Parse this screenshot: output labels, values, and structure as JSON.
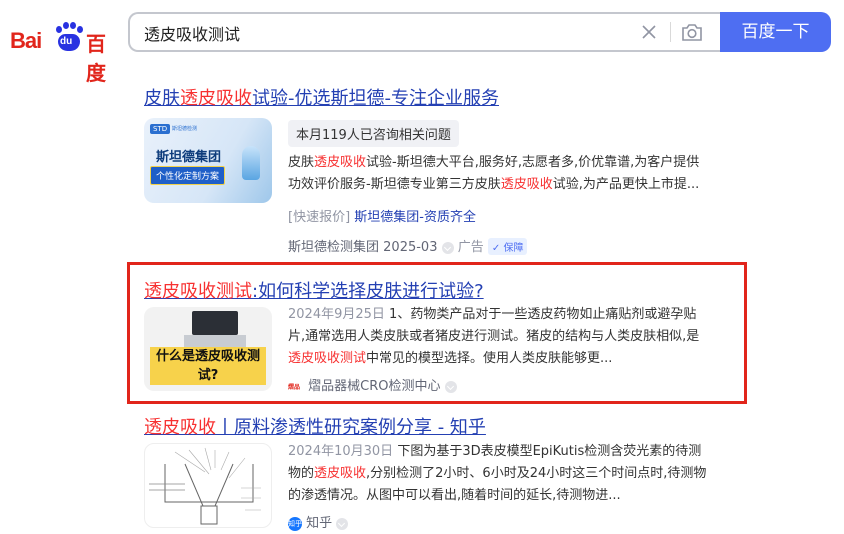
{
  "logo": {
    "bai": "Bai",
    "du": "du",
    "cn": "百度"
  },
  "search": {
    "query": "透皮吸收测试",
    "button_label": "百度一下"
  },
  "results": [
    {
      "title_pre": "皮肤",
      "title_hl": "透皮吸收",
      "title_post": "试验-优选斯坦德-专注企业服务",
      "thumb": {
        "logo": "STD",
        "logo_sub": "斯坦德检测",
        "headline": "斯坦德集团",
        "banner": "个性化定制方案"
      },
      "consult": "本月119人已咨询相关问题",
      "snip": [
        {
          "t": "皮肤",
          "hl": false
        },
        {
          "t": "透皮吸收",
          "hl": true
        },
        {
          "t": "试验-斯坦德大平台,服务好,志愿者多,价优靠谱,为客户提供功效评价服务-斯坦德专业第三方皮肤",
          "hl": false
        },
        {
          "t": "透皮吸收",
          "hl": true
        },
        {
          "t": "试验,为产品更快上市提...",
          "hl": false
        }
      ],
      "quick_tag": "[快速报价]",
      "quick_link": "斯坦德集团-资质齐全",
      "source": "斯坦德检测集团",
      "date": "2025-03",
      "ad": "广告",
      "guarantee": "保障"
    },
    {
      "title_hl": "透皮吸收测试",
      "title_post": ":如何科学选择皮肤进行试验?",
      "thumb": {
        "caption": "什么是透皮吸收测试?"
      },
      "date": "2024年9月25日",
      "snip": [
        {
          "t": "1、药物类产品对于一些透皮药物如止痛贴剂或避孕贴片,通常选用人类皮肤或者猪皮进行测试。猪皮的结构与人类皮肤相似,是",
          "hl": false
        },
        {
          "t": "透皮吸收测试",
          "hl": true
        },
        {
          "t": "中常见的模型选择。使用人类皮肤能够更...",
          "hl": false
        }
      ],
      "source": "熠品器械CRO检测中心",
      "source_logo": "熠品"
    },
    {
      "title_hl": "透皮吸收",
      "title_post": "丨原料渗透性研究案例分享 - 知乎",
      "date": "2024年10月30日",
      "snip": [
        {
          "t": "下图为基于3D表皮模型EpiKutis检测含荧光素的待测物的",
          "hl": false
        },
        {
          "t": "透皮吸收",
          "hl": true
        },
        {
          "t": ",分别检测了2小时、6小时及24小时这三个时间点时,待测物的渗透情况。从图中可以看出,随着时间的延长,待测物进...",
          "hl": false
        }
      ],
      "source": "知乎",
      "source_badge": "知乎"
    }
  ],
  "colors": {
    "accent": "#4e6ef2",
    "link": "#2440b3",
    "highlight": "#f73131",
    "frame": "#e1251b"
  }
}
